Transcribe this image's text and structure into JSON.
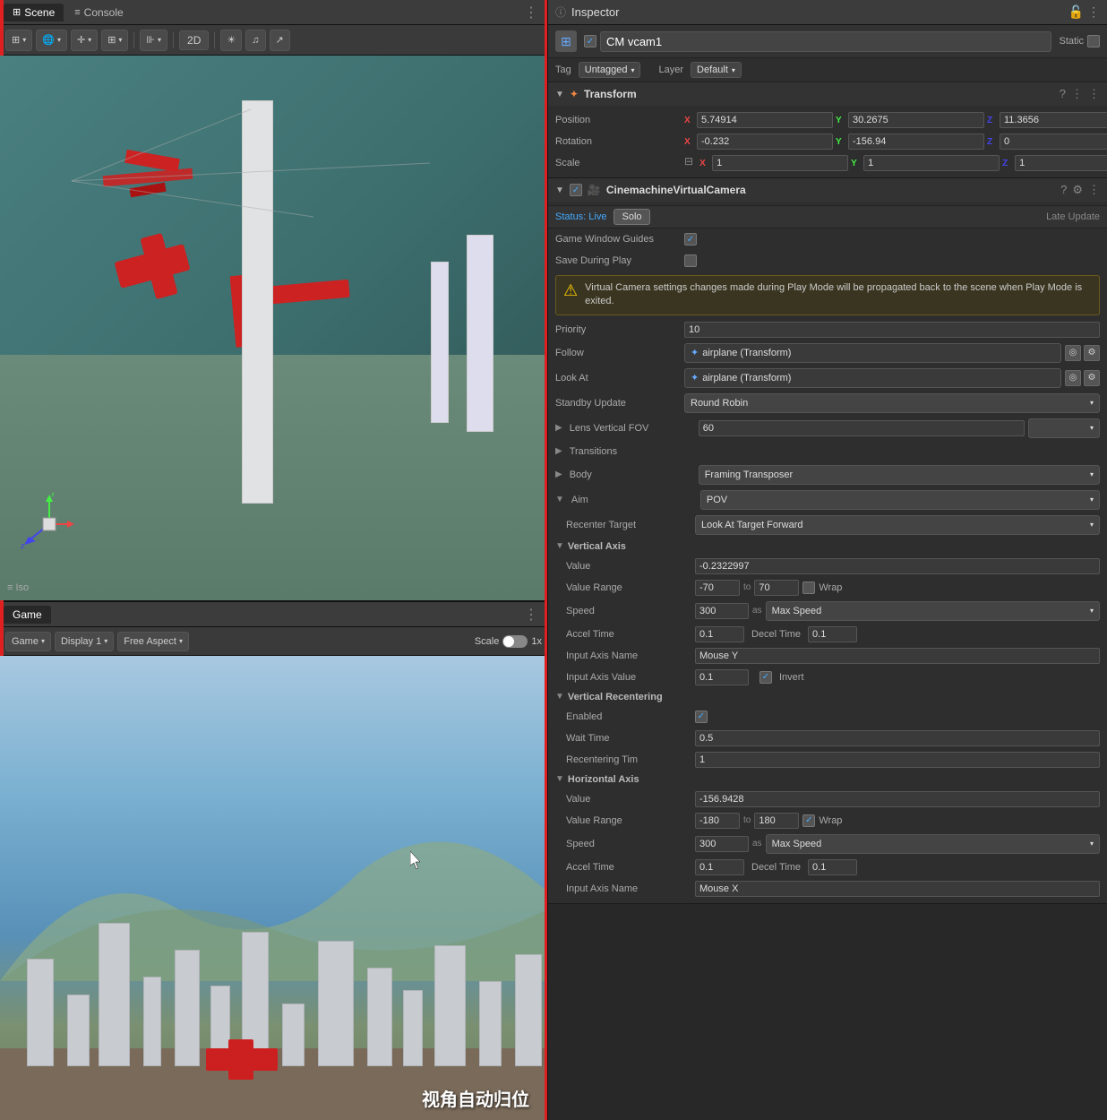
{
  "left": {
    "tabs": [
      {
        "id": "scene",
        "label": "Scene",
        "icon": "⊞",
        "active": true
      },
      {
        "id": "console",
        "label": "Console",
        "icon": "≡",
        "active": false
      }
    ],
    "scene_toolbar": {
      "btn1": "⊞▾",
      "btn2": "🌐▾",
      "btn3": "⊕▾",
      "btn4": "⊞▾",
      "btn5": "|||▾",
      "btn_2d": "2D",
      "btn_light": "☀",
      "btn_audio": "♪",
      "btn_gizmos": "↗"
    },
    "iso_label": "≡ Iso",
    "game": {
      "tab_label": "Game",
      "toolbar": {
        "display_label": "Game",
        "display_dropdown": "Display 1",
        "aspect_dropdown": "Free Aspect",
        "scale_label": "Scale",
        "scale_value": "1x"
      }
    },
    "chinese_text": "视角自动归位"
  },
  "inspector": {
    "title": "Inspector",
    "lock_icon": "🔒",
    "dots_icon": "⋮",
    "object": {
      "name": "CM vcam1",
      "static_label": "Static",
      "tag_label": "Tag",
      "tag_value": "Untagged",
      "layer_label": "Layer",
      "layer_value": "Default"
    },
    "transform": {
      "title": "Transform",
      "position_label": "Position",
      "position_x": "5.74914",
      "position_y": "30.2675",
      "position_z": "11.3656",
      "rotation_label": "Rotation",
      "rotation_x": "-0.232",
      "rotation_y": "-156.94",
      "rotation_z": "0",
      "scale_label": "Scale",
      "scale_icon": "⊟",
      "scale_x": "1",
      "scale_y": "1",
      "scale_z": "1"
    },
    "cinemachine": {
      "title": "CinemachineVirtualCamera",
      "status_label": "Status: Live",
      "solo_btn": "Solo",
      "late_update": "Late Update",
      "game_window_guides_label": "Game Window Guides",
      "game_window_guides_checked": true,
      "save_during_play_label": "Save During Play",
      "save_during_play_checked": false,
      "warning_text": "Virtual Camera settings changes made during Play Mode will be propagated back to the scene when Play Mode is exited.",
      "priority_label": "Priority",
      "priority_value": "10",
      "follow_label": "Follow",
      "follow_value": "airplane (Transform)",
      "look_at_label": "Look At",
      "look_at_value": "airplane (Transform)",
      "standby_update_label": "Standby Update",
      "standby_update_value": "Round Robin",
      "lens_fov_label": "Lens Vertical FOV",
      "lens_fov_value": "60",
      "transitions_label": "Transitions",
      "body_label": "Body",
      "body_value": "Framing Transposer",
      "aim_label": "Aim",
      "aim_value": "POV",
      "recenter_target_label": "Recenter Target",
      "recenter_target_value": "Look At Target Forward",
      "vertical_axis": {
        "title": "Vertical Axis",
        "value_label": "Value",
        "value": "-0.2322997",
        "value_range_label": "Value Range",
        "range_min": "-70",
        "range_to": "to",
        "range_max": "70",
        "wrap_label": "Wrap",
        "wrap_checked": false,
        "speed_label": "Speed",
        "speed_value": "300",
        "speed_as": "as",
        "speed_type": "Max Speed",
        "accel_label": "Accel Time",
        "accel_value": "0.1",
        "decel_label": "Decel Time",
        "decel_value": "0.1",
        "input_axis_name_label": "Input Axis Name",
        "input_axis_name_value": "Mouse Y",
        "input_axis_value_label": "Input Axis Value",
        "input_axis_value": "0.1",
        "invert_label": "Invert",
        "invert_checked": true
      },
      "vertical_recentering": {
        "title": "Vertical Recentering",
        "enabled_label": "Enabled",
        "enabled_checked": true,
        "wait_time_label": "Wait Time",
        "wait_time_value": "0.5",
        "recentering_time_label": "Recentering Tim",
        "recentering_time_value": "1"
      },
      "horizontal_axis": {
        "title": "Horizontal Axis",
        "value_label": "Value",
        "value": "-156.9428",
        "value_range_label": "Value Range",
        "range_min": "-180",
        "range_to": "to",
        "range_max": "180",
        "wrap_label": "Wrap",
        "wrap_checked": true,
        "speed_label": "Speed",
        "speed_value": "300",
        "speed_as": "as",
        "speed_type": "Max Speed",
        "accel_label": "Accel Time",
        "accel_value": "0.1",
        "decel_label": "Decel Time",
        "decel_value": "0.1",
        "input_axis_name_label": "Input Axis Name",
        "input_axis_name_value": "Mouse X"
      }
    }
  }
}
